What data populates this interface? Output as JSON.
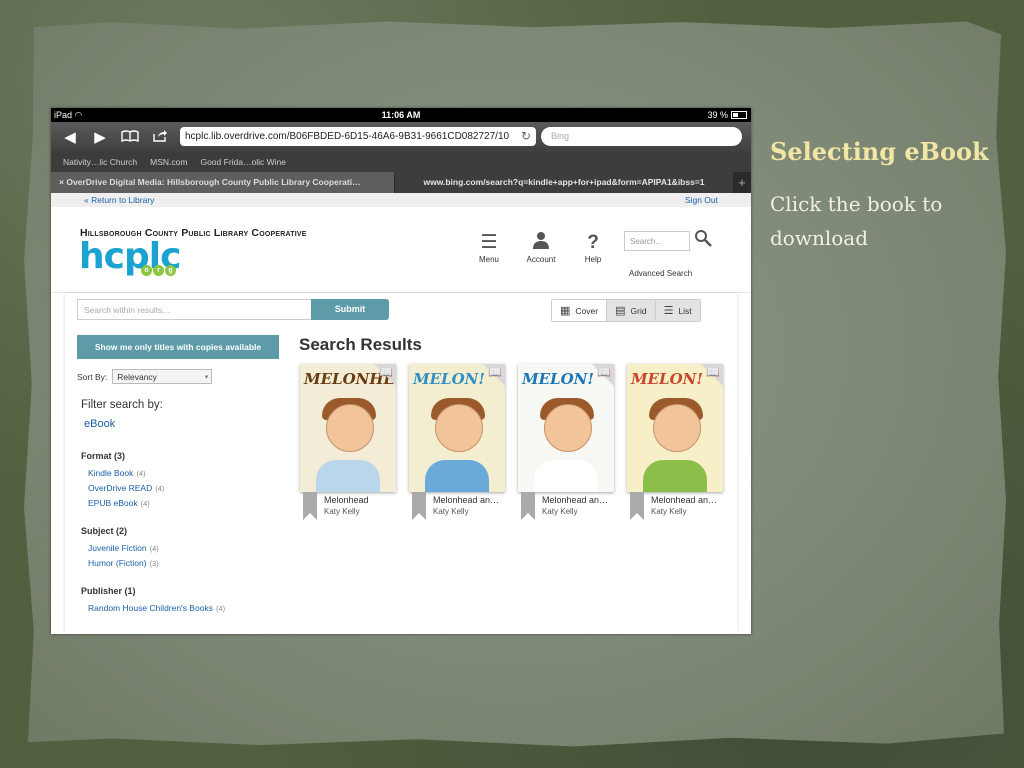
{
  "slide": {
    "title": "Selecting eBook",
    "body": "Click the book to download"
  },
  "status_bar": {
    "device": "iPad",
    "time": "11:06 AM",
    "battery": "39 %"
  },
  "browser": {
    "url": "hcplc.lib.overdrive.com/B06FBDED-6D15-46A6-9B31-9661CD082727/10",
    "search_placeholder": "Bing",
    "bookmarks": [
      "Nativity…lic Church",
      "MSN.com",
      "Good Frida…olic Wine"
    ],
    "tabs": [
      {
        "label": "OverDrive Digital Media: Hillsborough County Public Library Cooperati…"
      },
      {
        "label": "www.bing.com/search?q=kindle+app+for+ipad&form=APIPA1&ibss=1"
      }
    ]
  },
  "page": {
    "return_link": "« Return to Library",
    "sign_out": "Sign Out",
    "org_name": "Hillsborough County Public Library Cooperative",
    "logo_text": "hcplc",
    "logo_suffix": [
      "o",
      "r",
      "g"
    ],
    "nav": {
      "menu": "Menu",
      "account": "Account",
      "help": "Help"
    },
    "site_search_placeholder": "Search...",
    "advanced_search": "Advanced Search",
    "within_placeholder": "Search within results...",
    "submit": "Submit",
    "views": {
      "cover": "Cover",
      "grid": "Grid",
      "list": "List"
    },
    "show_me": "Show me only titles with copies available",
    "sort_label": "Sort By:",
    "sort_value": "Relevancy",
    "filter_title": "Filter search by:",
    "filter_ebook": "eBook",
    "facets": [
      {
        "heading": "Format (3)",
        "items": [
          {
            "label": "Kindle Book",
            "count": "(4)"
          },
          {
            "label": "OverDrive READ",
            "count": "(4)"
          },
          {
            "label": "EPUB eBook",
            "count": "(4)"
          }
        ]
      },
      {
        "heading": "Subject (2)",
        "items": [
          {
            "label": "Juvenile Fiction",
            "count": "(4)"
          },
          {
            "label": "Humor (Fiction)",
            "count": "(3)"
          }
        ]
      },
      {
        "heading": "Publisher (1)",
        "items": [
          {
            "label": "Random House Children's Books",
            "count": "(4)"
          }
        ]
      }
    ],
    "results_title": "Search Results",
    "books": [
      {
        "cover_text": "MELONHEAD",
        "title": "Melonhead",
        "author": "Katy Kelly",
        "bg": "#f3ecd7",
        "title_color": "#6a3b12",
        "shirt": "#b9d6ea"
      },
      {
        "cover_text": "MELON!",
        "title": "Melonhead an…",
        "author": "Katy Kelly",
        "bg": "#f3eecf",
        "title_color": "#2f8fc6",
        "shirt": "#6aa9d8"
      },
      {
        "cover_text": "MELON!",
        "title": "Melonhead an…",
        "author": "Katy Kelly",
        "bg": "#f7f7f3",
        "title_color": "#1c75b5",
        "shirt": "#ffffff"
      },
      {
        "cover_text": "MELON!",
        "title": "Melonhead an…",
        "author": "Katy Kelly",
        "bg": "#f6efc8",
        "title_color": "#c9462b",
        "shirt": "#8cbf4a"
      }
    ]
  },
  "colors": {
    "accent_teal": "#5d9ba8",
    "link_blue": "#1a5fa6",
    "logo_blue": "#1aa2d0",
    "slide_title": "#f1e6a4"
  }
}
